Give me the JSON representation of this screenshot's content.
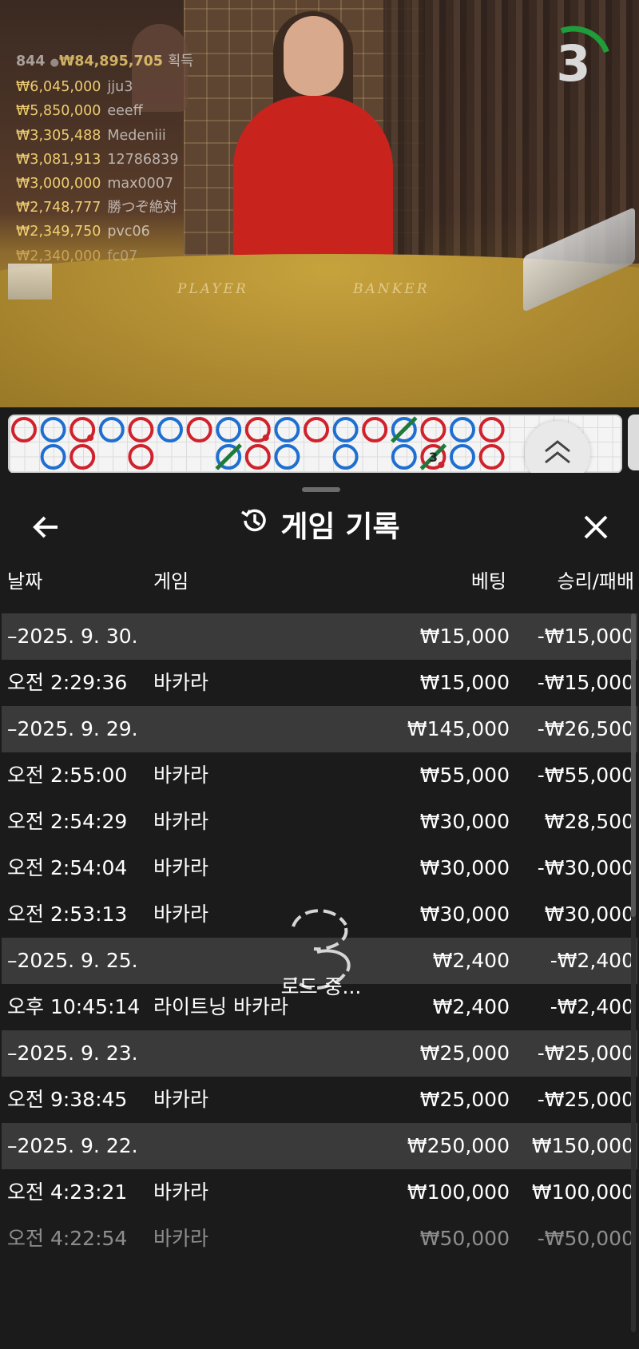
{
  "video": {
    "table_labels": {
      "player": "PLAYER",
      "banker": "BANKER"
    },
    "winners": {
      "count": "844",
      "total": "₩84,895,705",
      "total_label": "획득",
      "list": [
        {
          "amount": "₩6,045,000",
          "name": "jju3"
        },
        {
          "amount": "₩5,850,000",
          "name": "eeeff"
        },
        {
          "amount": "₩3,305,488",
          "name": "Medeniii"
        },
        {
          "amount": "₩3,081,913",
          "name": "12786839"
        },
        {
          "amount": "₩3,000,000",
          "name": "max0007"
        },
        {
          "amount": "₩2,748,777",
          "name": "勝つぞ絶対"
        },
        {
          "amount": "₩2,349,750",
          "name": "pvc06"
        },
        {
          "amount": "₩2,340,000",
          "name": "fc07"
        }
      ]
    },
    "countdown": {
      "value": "3",
      "remaining_fraction": 0.25,
      "color": "#1f9d3a"
    }
  },
  "road": {
    "colors": {
      "player": "#1f6fd1",
      "banker": "#d0222c",
      "tie": "#1f7a3a"
    },
    "cells": [
      {
        "col": 0,
        "row": 0,
        "side": "banker"
      },
      {
        "col": 1,
        "row": 0,
        "side": "player"
      },
      {
        "col": 1,
        "row": 1,
        "side": "player"
      },
      {
        "col": 2,
        "row": 0,
        "side": "banker",
        "pair": true
      },
      {
        "col": 2,
        "row": 1,
        "side": "banker"
      },
      {
        "col": 3,
        "row": 0,
        "side": "player"
      },
      {
        "col": 4,
        "row": 0,
        "side": "banker"
      },
      {
        "col": 4,
        "row": 1,
        "side": "banker"
      },
      {
        "col": 5,
        "row": 0,
        "side": "player"
      },
      {
        "col": 6,
        "row": 0,
        "side": "banker"
      },
      {
        "col": 7,
        "row": 0,
        "side": "player"
      },
      {
        "col": 7,
        "row": 1,
        "side": "player",
        "tie": true
      },
      {
        "col": 8,
        "row": 0,
        "side": "banker",
        "pair": true
      },
      {
        "col": 8,
        "row": 1,
        "side": "banker"
      },
      {
        "col": 9,
        "row": 0,
        "side": "player"
      },
      {
        "col": 9,
        "row": 1,
        "side": "player"
      },
      {
        "col": 10,
        "row": 0,
        "side": "banker"
      },
      {
        "col": 11,
        "row": 0,
        "side": "player"
      },
      {
        "col": 11,
        "row": 1,
        "side": "player"
      },
      {
        "col": 12,
        "row": 0,
        "side": "banker"
      },
      {
        "col": 13,
        "row": 0,
        "side": "player",
        "tie": true
      },
      {
        "col": 13,
        "row": 1,
        "side": "player"
      },
      {
        "col": 14,
        "row": 0,
        "side": "banker"
      },
      {
        "col": 14,
        "row": 1,
        "side": "banker",
        "tie": true,
        "tie_count": "3",
        "pair": true
      },
      {
        "col": 15,
        "row": 0,
        "side": "player"
      },
      {
        "col": 15,
        "row": 1,
        "side": "player"
      },
      {
        "col": 16,
        "row": 0,
        "side": "banker"
      },
      {
        "col": 16,
        "row": 1,
        "side": "banker"
      }
    ]
  },
  "panel": {
    "title": "게임 기록",
    "columns": {
      "date": "날짜",
      "game": "게임",
      "bet": "베팅",
      "winloss": "승리/패배"
    },
    "rows": [
      {
        "type": "date",
        "c1": "–2025. 9. 30.",
        "c2": "",
        "c3": "₩15,000",
        "c4": "-₩15,000"
      },
      {
        "type": "item",
        "c1": "오전 2:29:36",
        "c2": "바카라",
        "c3": "₩15,000",
        "c4": "-₩15,000"
      },
      {
        "type": "date",
        "c1": "–2025. 9. 29.",
        "c2": "",
        "c3": "₩145,000",
        "c4": "-₩26,500"
      },
      {
        "type": "item",
        "c1": "오전 2:55:00",
        "c2": "바카라",
        "c3": "₩55,000",
        "c4": "-₩55,000"
      },
      {
        "type": "item",
        "c1": "오전 2:54:29",
        "c2": "바카라",
        "c3": "₩30,000",
        "c4": "₩28,500"
      },
      {
        "type": "item",
        "c1": "오전 2:54:04",
        "c2": "바카라",
        "c3": "₩30,000",
        "c4": "-₩30,000"
      },
      {
        "type": "item",
        "c1": "오전 2:53:13",
        "c2": "바카라",
        "c3": "₩30,000",
        "c4": "₩30,000"
      },
      {
        "type": "date",
        "c1": "–2025. 9. 25.",
        "c2": "",
        "c3": "₩2,400",
        "c4": "-₩2,400"
      },
      {
        "type": "item",
        "c1": "오후 10:45:14",
        "c2": "라이트닝 바카라",
        "c3": "₩2,400",
        "c4": "-₩2,400"
      },
      {
        "type": "date",
        "c1": "–2025. 9. 23.",
        "c2": "",
        "c3": "₩25,000",
        "c4": "-₩25,000"
      },
      {
        "type": "item",
        "c1": "오전 9:38:45",
        "c2": "바카라",
        "c3": "₩25,000",
        "c4": "-₩25,000"
      },
      {
        "type": "date",
        "c1": "–2025. 9. 22.",
        "c2": "",
        "c3": "₩250,000",
        "c4": "₩150,000"
      },
      {
        "type": "item",
        "c1": "오전 4:23:21",
        "c2": "바카라",
        "c3": "₩100,000",
        "c4": "₩100,000"
      },
      {
        "type": "item",
        "c1": "오전 4:22:54",
        "c2": "바카라",
        "c3": "₩50,000",
        "c4": "-₩50,000",
        "faded": true
      }
    ],
    "loading_text": "로드 중..."
  }
}
